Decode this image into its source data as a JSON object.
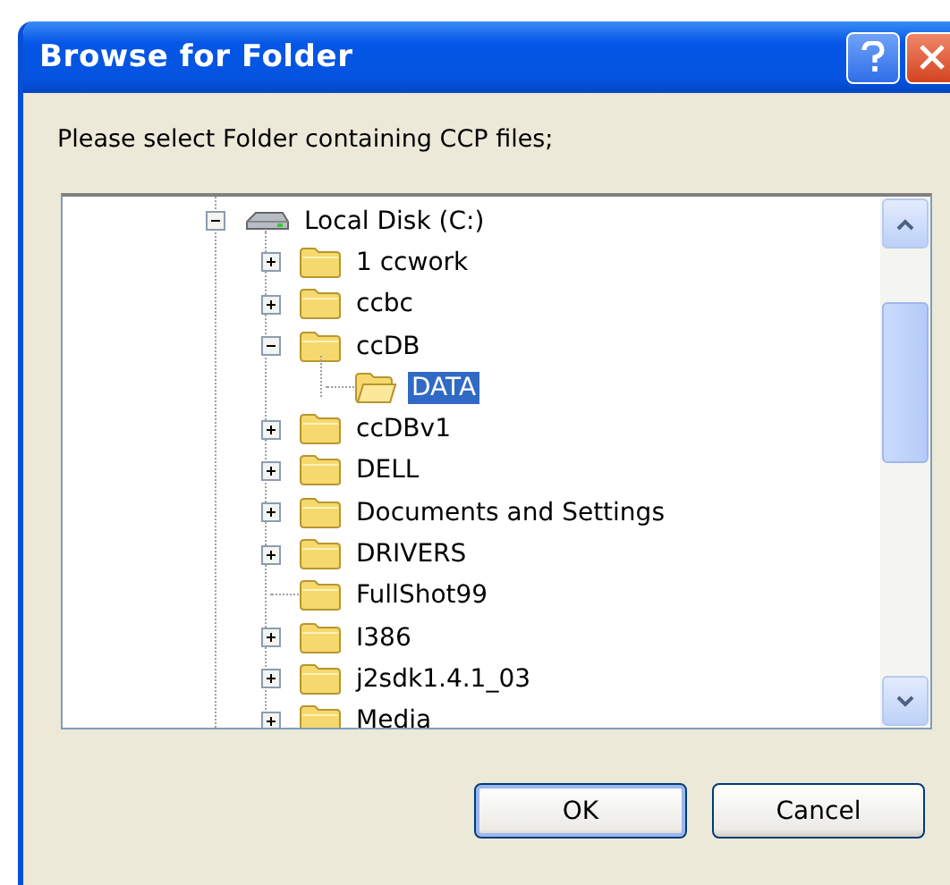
{
  "window": {
    "title": "Browse for Folder"
  },
  "prompt": "Please select Folder containing CCP files;",
  "tree": [
    {
      "label": "Local Disk (C:)",
      "kind": "drive",
      "expandable": true,
      "expanded": true,
      "selected": false,
      "children": [
        {
          "label": "1 ccwork",
          "kind": "folder",
          "expandable": true,
          "expanded": false,
          "selected": false
        },
        {
          "label": "ccbc",
          "kind": "folder",
          "expandable": true,
          "expanded": false,
          "selected": false
        },
        {
          "label": "ccDB",
          "kind": "folder",
          "expandable": true,
          "expanded": true,
          "selected": false,
          "children": [
            {
              "label": "DATA",
              "kind": "open-folder",
              "expandable": false,
              "selected": true
            }
          ]
        },
        {
          "label": "ccDBv1",
          "kind": "folder",
          "expandable": true,
          "expanded": false,
          "selected": false
        },
        {
          "label": "DELL",
          "kind": "folder",
          "expandable": true,
          "expanded": false,
          "selected": false
        },
        {
          "label": "Documents and Settings",
          "kind": "folder",
          "expandable": true,
          "expanded": false,
          "selected": false
        },
        {
          "label": "DRIVERS",
          "kind": "folder",
          "expandable": true,
          "expanded": false,
          "selected": false
        },
        {
          "label": "FullShot99",
          "kind": "folder",
          "expandable": false,
          "selected": false
        },
        {
          "label": "I386",
          "kind": "folder",
          "expandable": true,
          "expanded": false,
          "selected": false
        },
        {
          "label": "j2sdk1.4.1_03",
          "kind": "folder",
          "expandable": true,
          "expanded": false,
          "selected": false
        },
        {
          "label": "Media",
          "kind": "folder",
          "expandable": true,
          "expanded": false,
          "selected": false
        }
      ]
    }
  ],
  "buttons": [
    {
      "label": "OK",
      "default": true
    },
    {
      "label": "Cancel",
      "default": false
    }
  ]
}
